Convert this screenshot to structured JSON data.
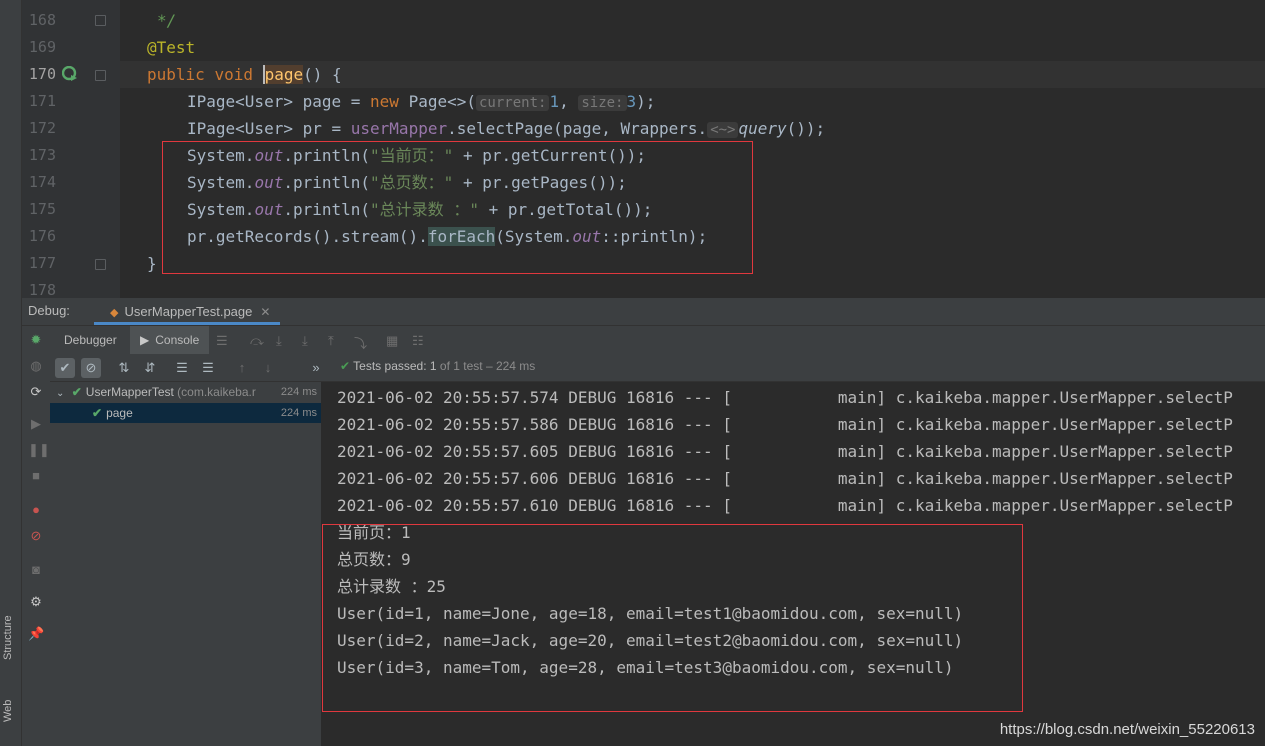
{
  "editor": {
    "lines": [
      {
        "num": "168",
        "text": "*/"
      },
      {
        "num": "169",
        "text": "@Test"
      },
      {
        "num": "170",
        "text": "public void page() {"
      },
      {
        "num": "171",
        "parts": [
          "IPage<User> page = ",
          "new",
          " Page<>(",
          "current:",
          "1",
          ", ",
          "size:",
          "3",
          ");"
        ]
      },
      {
        "num": "172",
        "parts": [
          "IPage<User> pr = ",
          "userMapper",
          ".selectPage(page, Wrappers.",
          "<~>",
          "query",
          "());"
        ]
      },
      {
        "num": "173",
        "parts": [
          "System.",
          "out",
          ".println(",
          "\"当前页：\"",
          " + pr.getCurrent());"
        ]
      },
      {
        "num": "174",
        "parts": [
          "System.",
          "out",
          ".println(",
          "\"总页数：\"",
          " + pr.getPages());"
        ]
      },
      {
        "num": "175",
        "parts": [
          "System.",
          "out",
          ".println(",
          "\"总计录数 ：\"",
          " + pr.getTotal());"
        ]
      },
      {
        "num": "176",
        "parts": [
          "pr.getRecords().stream().",
          "forEach",
          "(System.",
          "out",
          "::println);"
        ]
      },
      {
        "num": "177",
        "text": "}"
      },
      {
        "num": "178",
        "text": ""
      }
    ],
    "keyword_public": "public",
    "keyword_void": "void",
    "method_page": "page",
    "method_rest": "() {"
  },
  "debug": {
    "label": "Debug:",
    "run_tab": "UserMapperTest.page",
    "tabs": [
      "Debugger",
      "Console"
    ],
    "tests_status_passed": "Tests passed:",
    "tests_status_count": "1",
    "tests_status_rest": "of 1 test – 224 ms"
  },
  "tree": [
    {
      "label": "UserMapperTest",
      "sub": "(com.kaikeba.r",
      "time": "224 ms"
    },
    {
      "label": "page",
      "time": "224 ms"
    }
  ],
  "console": {
    "lines": [
      "2021-06-02 20:55:57.574 DEBUG 16816 --- [           main] c.kaikeba.mapper.UserMapper.selectP",
      "2021-06-02 20:55:57.586 DEBUG 16816 --- [           main] c.kaikeba.mapper.UserMapper.selectP",
      "2021-06-02 20:55:57.605 DEBUG 16816 --- [           main] c.kaikeba.mapper.UserMapper.selectP",
      "2021-06-02 20:55:57.606 DEBUG 16816 --- [           main] c.kaikeba.mapper.UserMapper.selectP",
      "2021-06-02 20:55:57.610 DEBUG 16816 --- [           main] c.kaikeba.mapper.UserMapper.selectP",
      "当前页：1",
      "总页数：9",
      "总计录数 ：25",
      "User(id=1, name=Jone, age=18, email=test1@baomidou.com, sex=null)",
      "User(id=2, name=Jack, age=20, email=test2@baomidou.com, sex=null)",
      "User(id=3, name=Tom, age=28, email=test3@baomidou.com, sex=null)"
    ]
  },
  "side_labels": {
    "structure": "Structure",
    "web": "Web"
  },
  "watermark": "https://blog.csdn.net/weixin_55220613",
  "colors": {
    "accent_red": "#e0383e",
    "pass_green": "#59a869",
    "selection": "#0d293e"
  }
}
